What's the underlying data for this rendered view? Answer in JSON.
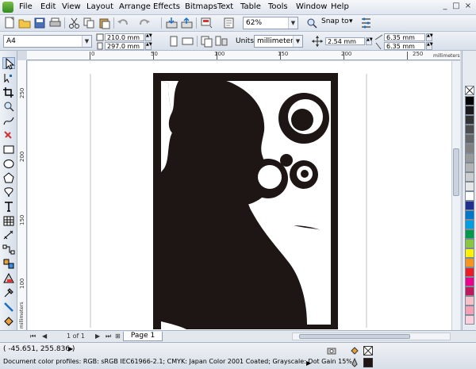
{
  "menu": {
    "items": [
      "File",
      "Edit",
      "View",
      "Layout",
      "Arrange",
      "Effects",
      "Bitmaps",
      "Text",
      "Table",
      "Tools",
      "Window",
      "Help"
    ],
    "window_controls": [
      "_",
      "□",
      "×"
    ]
  },
  "toolbar": {
    "zoom_value": "62%",
    "snap_label": "Snap to"
  },
  "property_bar": {
    "paper_size": "A4",
    "width": "210.0 mm",
    "height": "297.0 mm",
    "units_label": "Units:",
    "units_value": "millimeters",
    "nudge": "2.54 mm",
    "dup_x": "6.35 mm",
    "dup_y": "6.35 mm"
  },
  "ruler": {
    "top_ticks": [
      "0",
      "50",
      "100",
      "150",
      "200",
      "250"
    ],
    "top_unit": "millimeters",
    "left_ticks": [
      "250",
      "200",
      "150",
      "100"
    ],
    "left_unit": "millimeters"
  },
  "pages": {
    "counter": "1 of 1",
    "tab_label": "Page 1"
  },
  "status": {
    "coordinates": "( -45.651, 255.836 )",
    "profiles": "Document color profiles: RGB: sRGB IEC61966-2.1; CMYK: Japan Color 2001 Coated; Grayscale: Dot Gain 15%"
  },
  "colors": {
    "artwork": "#1e1614",
    "canvas": "#ffffff",
    "chrome": "#dde3ec",
    "palette": [
      "#ffffff",
      "#000000",
      "#1a1a1a",
      "#333333",
      "#4d4d4d",
      "#666666",
      "#808080",
      "#999999",
      "#b3b3b3",
      "#cccccc",
      "#e6e6e6",
      "#ffffff",
      "#1f2f8f",
      "#0077c8",
      "#00a0e0",
      "#009b48",
      "#8cc63e",
      "#fff200",
      "#f7941d",
      "#ed1c24",
      "#ec008c",
      "#c2185b",
      "#f8c0c8",
      "#f5a0b5",
      "#fbd0dc",
      "#fce4ec"
    ]
  },
  "icons": [
    "new-icon",
    "open-icon",
    "save-icon",
    "print-icon",
    "cut-icon",
    "copy-icon",
    "paste-icon",
    "undo-icon",
    "redo-icon",
    "import-icon",
    "export-icon",
    "publish-icon",
    "zoom-icon",
    "options-icon"
  ]
}
